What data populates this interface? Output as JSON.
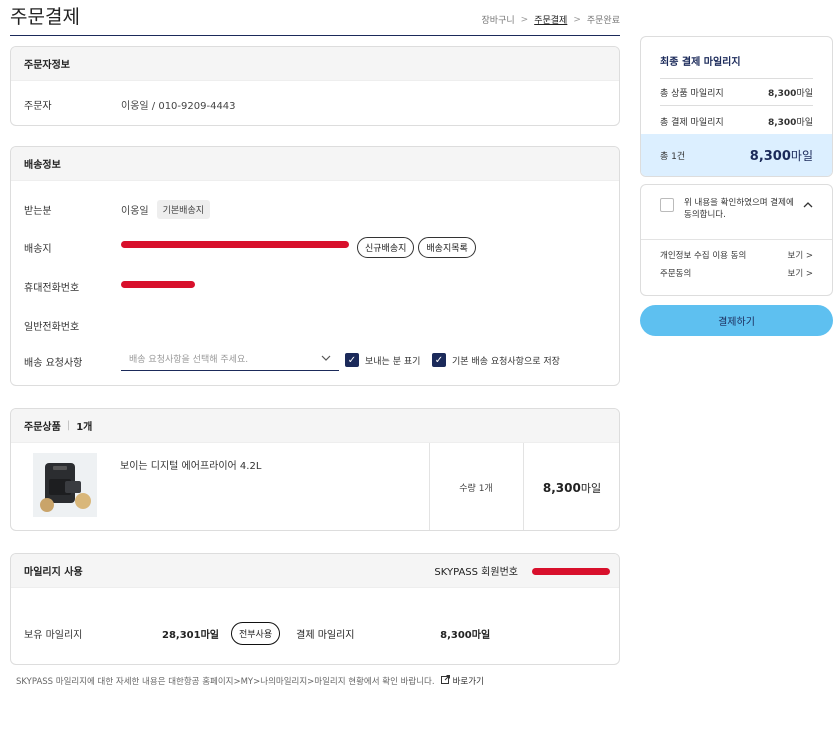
{
  "page": {
    "title": "주문결제",
    "breadcrumb": [
      "장바구니",
      "주문결제",
      "주문완료"
    ],
    "breadcrumb_sep": ">"
  },
  "orderer": {
    "heading": "주문자정보",
    "label": "주문자",
    "value": "이옹일 / 010-9209-4443"
  },
  "shipping": {
    "heading": "배송정보",
    "recipient_label": "받는분",
    "recipient_value": "이옹일",
    "default_tag": "기본배송지",
    "address_label": "배송지",
    "new_address_btn": "신규배송지",
    "address_list_btn": "배송지목록",
    "mobile_label": "휴대전화번호",
    "phone_label": "일반전화번호",
    "request_label": "배송 요청사항",
    "request_placeholder": "배송 요청사항을 선택해 주세요.",
    "sender_check_label": "보내는 분 표기",
    "save_default_label": "기본 배송 요청사항으로 저장"
  },
  "products": {
    "heading": "주문상품",
    "count": "1개",
    "name": "보이는 디지털 에어프라이어 4.2L",
    "qty": "수량 1개",
    "price_num": "8,300",
    "price_unit": "마일"
  },
  "mileage": {
    "heading": "마일리지 사용",
    "skypass_label": "SKYPASS 회원번호",
    "owned_label": "보유 마일리지",
    "owned_value": "28,301마일",
    "use_all_btn": "전부사용",
    "pay_label": "결제 마일리지",
    "pay_value": "8,300마일"
  },
  "footnote": {
    "text": "SKYPASS 마일리지에 대한 자세한 내용은 대한항공 홈페이지>MY>나의마일리지>마일리지 현황에서 확인 바랍니다.",
    "link": "바로가기"
  },
  "summary": {
    "heading": "최종 결제 마일리지",
    "rows": [
      {
        "label": "총 상품 마일리지",
        "num": "8,300",
        "unit": "마일"
      },
      {
        "label": "총 결제 마일리지",
        "num": "8,300",
        "unit": "마일"
      }
    ],
    "total_label": "총 1건",
    "total_num": "8,300",
    "total_unit": "마일"
  },
  "agreement": {
    "text": "위 내용을 확인하였으며 결제에 동의합니다.",
    "items": [
      {
        "label": "개인정보 수집 이용 동의",
        "link": "보기 >"
      },
      {
        "label": "주문동의",
        "link": "보기 >"
      }
    ]
  },
  "pay_button": "결제하기",
  "colors": {
    "navy": "#1b2a5a",
    "accent_blue": "#5ec0f0",
    "summary_bg": "#dcefff",
    "redaction": "#d8102c"
  }
}
